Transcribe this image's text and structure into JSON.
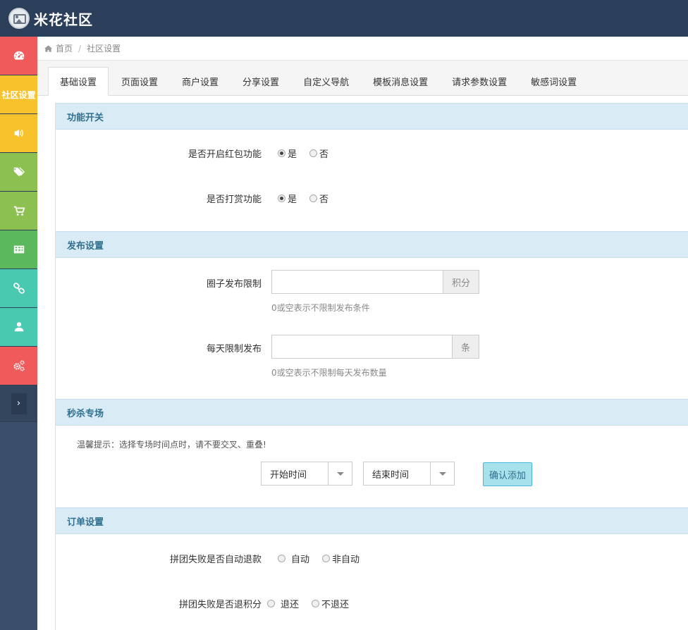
{
  "app": {
    "brand": "米花社区"
  },
  "sidebar": {
    "items": [
      {
        "icon": "dashboard-icon",
        "color": "#f05a5a",
        "label": ""
      },
      {
        "icon": "community-settings",
        "color": "#f8c22d",
        "label": "社区设置"
      },
      {
        "icon": "volume-icon",
        "color": "#f8c22d",
        "label": ""
      },
      {
        "icon": "tags-icon",
        "color": "#8cc152",
        "label": ""
      },
      {
        "icon": "cart-icon",
        "color": "#8cc152",
        "label": ""
      },
      {
        "icon": "table-icon",
        "color": "#5cb85c",
        "label": ""
      },
      {
        "icon": "link-icon",
        "color": "#48c9b0",
        "label": ""
      },
      {
        "icon": "user-icon",
        "color": "#48c9b0",
        "label": ""
      },
      {
        "icon": "gears-icon",
        "color": "#f05a5a",
        "label": ""
      }
    ],
    "toggle": "›"
  },
  "breadcrumb": {
    "home": "首页",
    "separator": "/",
    "current": "社区设置"
  },
  "tabs": [
    {
      "label": "基础设置",
      "active": true
    },
    {
      "label": "页面设置"
    },
    {
      "label": "商户设置"
    },
    {
      "label": "分享设置"
    },
    {
      "label": "自定义导航"
    },
    {
      "label": "模板消息设置"
    },
    {
      "label": "请求参数设置"
    },
    {
      "label": "敏感词设置"
    }
  ],
  "sections": {
    "func": {
      "title": "功能开关",
      "red_packet": {
        "label": "是否开启红包功能",
        "yes": "是",
        "no": "否",
        "selected": "yes"
      },
      "reward": {
        "label": "是否打赏功能",
        "yes": "是",
        "no": "否",
        "selected": "yes"
      }
    },
    "publish": {
      "title": "发布设置",
      "circle_limit": {
        "label": "圈子发布限制",
        "value": "",
        "addon": "积分",
        "help": "0或空表示不限制发布条件"
      },
      "daily_limit": {
        "label": "每天限制发布",
        "value": "",
        "addon": "条",
        "help": "0或空表示不限制每天发布数量"
      }
    },
    "flash": {
      "title": "秒杀专场",
      "tip": "温馨提示：选择专场时间点时，请不要交叉、重叠!",
      "start_time": "开始时间",
      "end_time": "结束时间",
      "confirm": "确认添加"
    },
    "order": {
      "title": "订单设置",
      "auto_refund": {
        "label": "拼团失败是否自动退款",
        "opt1": "自动",
        "opt2": "非自动"
      },
      "refund_points": {
        "label": "拼团失败是否退积分",
        "opt1": "退还",
        "opt2": "不退还"
      }
    }
  }
}
